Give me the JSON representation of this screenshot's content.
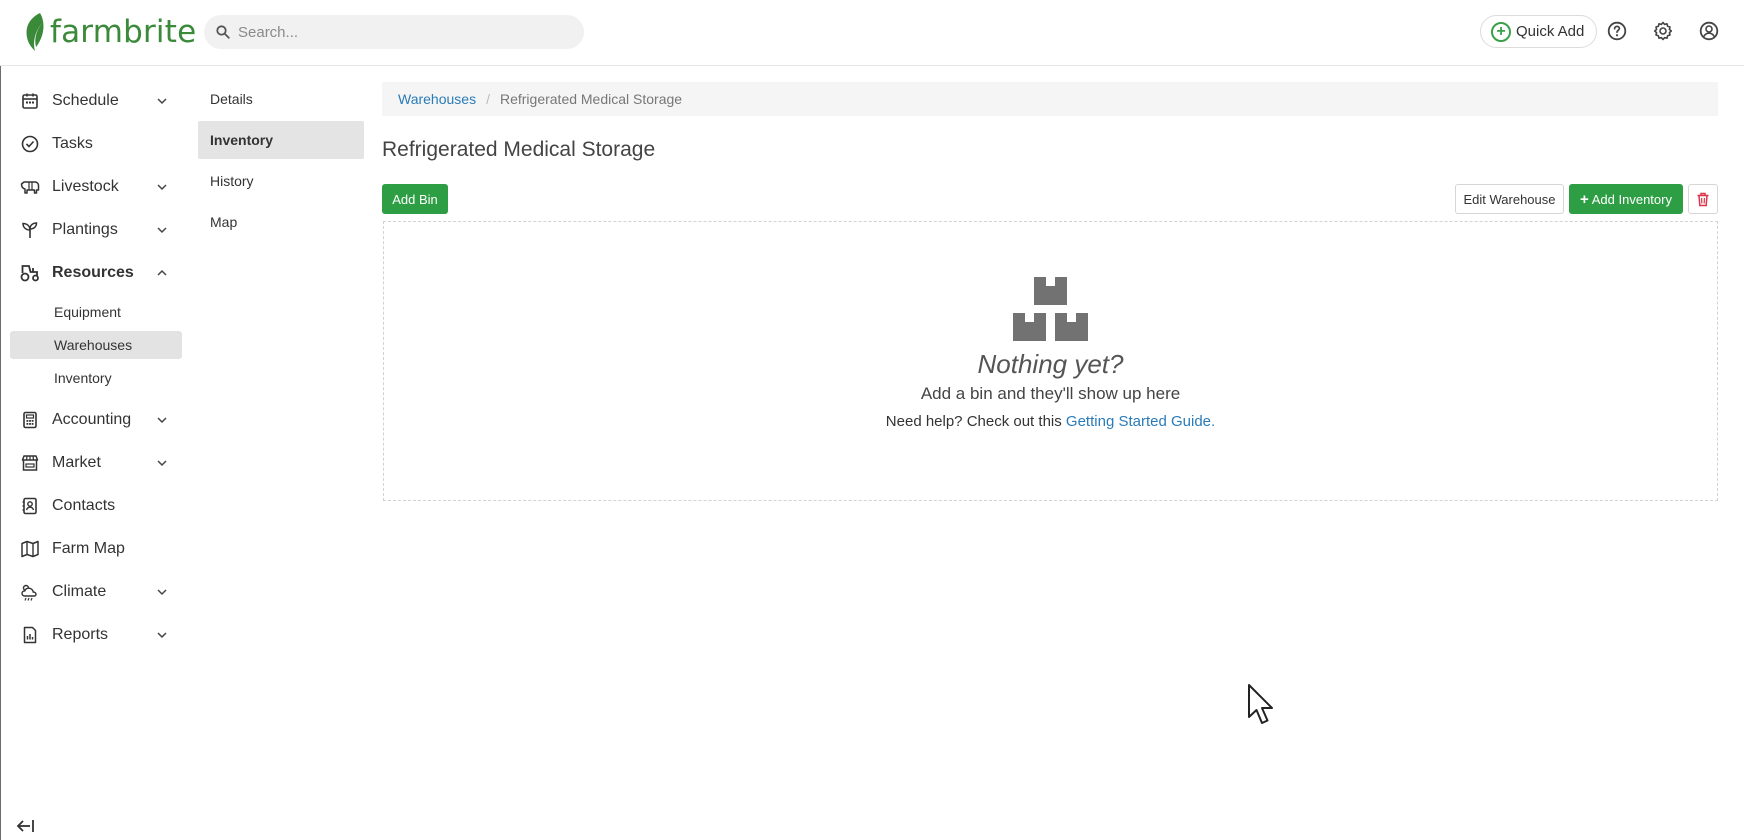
{
  "brand": {
    "name": "farmbrite",
    "color": "#3a8a3a"
  },
  "topbar": {
    "search_placeholder": "Search...",
    "quick_add_label": "Quick Add",
    "icons": [
      "help-icon",
      "settings-icon",
      "account-icon"
    ]
  },
  "sidebar": {
    "items": [
      {
        "label": "Schedule",
        "icon": "calendar-icon",
        "expandable": true
      },
      {
        "label": "Tasks",
        "icon": "check-circle-icon",
        "expandable": false
      },
      {
        "label": "Livestock",
        "icon": "cow-icon",
        "expandable": true
      },
      {
        "label": "Plantings",
        "icon": "sprout-icon",
        "expandable": true
      },
      {
        "label": "Resources",
        "icon": "tractor-icon",
        "expandable": true,
        "expanded": true
      },
      {
        "label": "Accounting",
        "icon": "calculator-icon",
        "expandable": true
      },
      {
        "label": "Market",
        "icon": "store-icon",
        "expandable": true
      },
      {
        "label": "Contacts",
        "icon": "contacts-icon",
        "expandable": false
      },
      {
        "label": "Farm Map",
        "icon": "map-icon",
        "expandable": false
      },
      {
        "label": "Climate",
        "icon": "weather-icon",
        "expandable": true
      },
      {
        "label": "Reports",
        "icon": "report-icon",
        "expandable": true
      }
    ],
    "resources_sub": [
      {
        "label": "Equipment"
      },
      {
        "label": "Warehouses",
        "active": true
      },
      {
        "label": "Inventory"
      }
    ]
  },
  "subnav": {
    "items": [
      {
        "label": "Details"
      },
      {
        "label": "Inventory",
        "active": true
      },
      {
        "label": "History"
      },
      {
        "label": "Map"
      }
    ]
  },
  "breadcrumb": {
    "parent": "Warehouses",
    "current": "Refrigerated Medical Storage"
  },
  "page": {
    "title": "Refrigerated Medical Storage",
    "add_bin_label": "Add Bin",
    "edit_warehouse_label": "Edit Warehouse",
    "add_inventory_label": "Add Inventory"
  },
  "empty_state": {
    "title": "Nothing yet?",
    "subtitle": "Add a bin and they'll show up here",
    "help_prefix": "Need help? Check out this ",
    "help_link": "Getting Started Guide."
  },
  "colors": {
    "green": "#2e9e44",
    "link": "#2a7bb8",
    "danger": "#d9364a"
  }
}
